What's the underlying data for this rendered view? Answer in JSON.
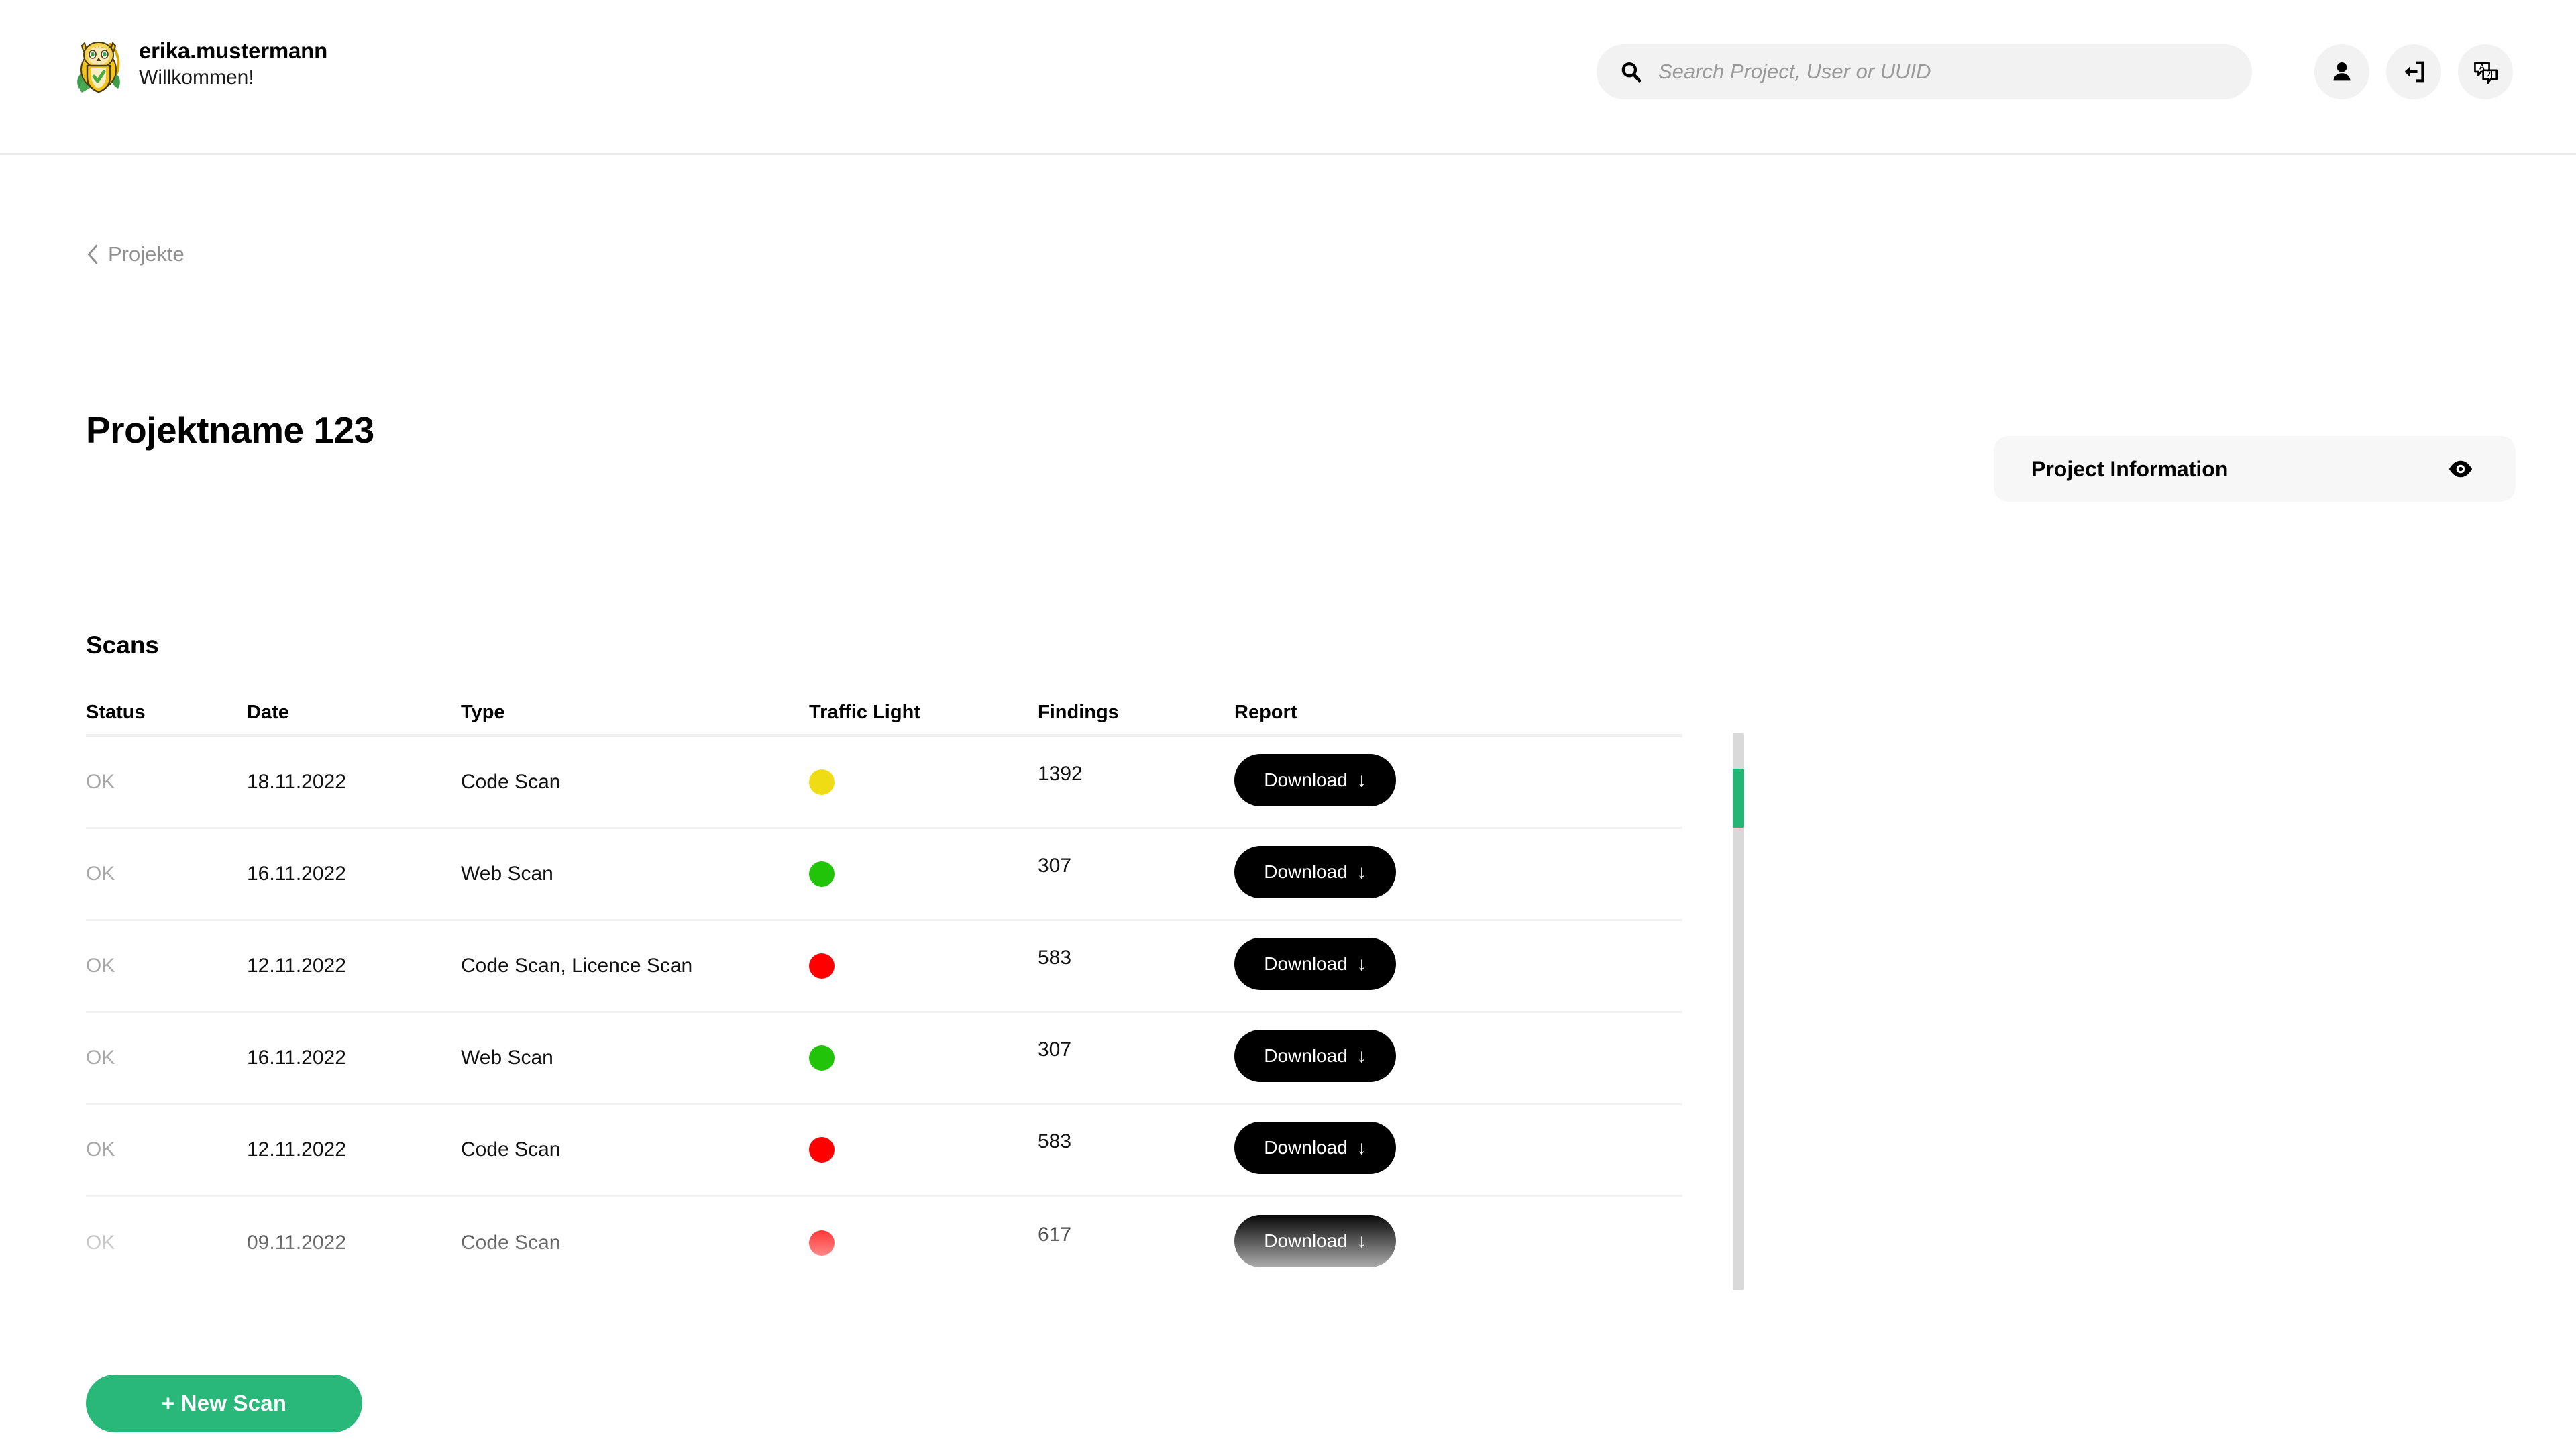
{
  "header": {
    "logo_icon": "owl-shield-logo",
    "user_name": "erika.mustermann",
    "welcome_text": "Willkommen!",
    "search": {
      "icon": "search-icon",
      "placeholder": "Search Project, User or UUID",
      "value": ""
    },
    "actions": [
      {
        "icon": "user-icon",
        "name": "profile-button"
      },
      {
        "icon": "logout-icon",
        "name": "logout-button"
      },
      {
        "icon": "translate-icon",
        "name": "language-button"
      }
    ]
  },
  "breadcrumb": {
    "icon": "chevron-left-icon",
    "label": "Projekte"
  },
  "page": {
    "title": "Projektname 123",
    "section_title": "Scans"
  },
  "project_information": {
    "label": "Project Information",
    "icon": "eye-icon"
  },
  "table": {
    "columns": [
      "Status",
      "Date",
      "Type",
      "Traffic Light",
      "Findings",
      "Report"
    ],
    "rows": [
      {
        "status": "OK",
        "date": "18.11.2022",
        "type": "Code Scan",
        "traffic_light": "#f0dc14",
        "traffic_label": "yellow",
        "findings": "1392",
        "report_label": "Download"
      },
      {
        "status": "OK",
        "date": "16.11.2022",
        "type": "Web Scan",
        "traffic_light": "#22c40a",
        "traffic_label": "green",
        "findings": "307",
        "report_label": "Download"
      },
      {
        "status": "OK",
        "date": "12.11.2022",
        "type": "Code Scan, Licence Scan",
        "traffic_light": "#ff0000",
        "traffic_label": "red",
        "findings": "583",
        "report_label": "Download"
      },
      {
        "status": "OK",
        "date": "16.11.2022",
        "type": "Web Scan",
        "traffic_light": "#22c40a",
        "traffic_label": "green",
        "findings": "307",
        "report_label": "Download"
      },
      {
        "status": "OK",
        "date": "12.11.2022",
        "type": "Code Scan",
        "traffic_light": "#ff0000",
        "traffic_label": "red",
        "findings": "583",
        "report_label": "Download"
      },
      {
        "status": "OK",
        "date": "09.11.2022",
        "type": "Code Scan",
        "traffic_light": "#ff0000",
        "traffic_label": "red",
        "findings": "617",
        "report_label": "Download"
      }
    ],
    "download_arrow": "↓"
  },
  "actions": {
    "new_scan_label": "+ New Scan"
  },
  "colors": {
    "accent_green": "#2ab87a",
    "scrollbar_thumb": "#22b573",
    "surface_gray": "#f2f2f2",
    "card_gray": "#f7f7f7",
    "muted_text": "#a8a8a8"
  }
}
